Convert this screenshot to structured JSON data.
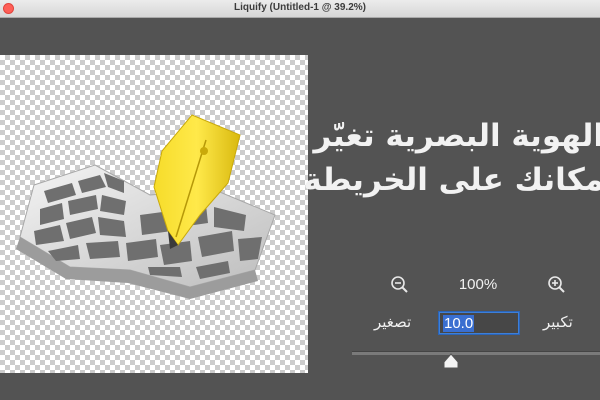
{
  "window": {
    "title": "Liquify (Untitled-1 @ 39.2%)"
  },
  "preview": {
    "description_icon": "map-with-pen-icon"
  },
  "headline": {
    "line1": "الهوية البصرية تغيّر",
    "line2": "مكانك على الخريطة"
  },
  "zoom": {
    "level": "100%",
    "shrink_label": "تصغير",
    "enlarge_label": "تكبير",
    "input_value": "10.0",
    "slider_fraction": 0.36
  },
  "colors": {
    "background": "#535353",
    "pen": "#f2d524",
    "map": "#d9d9d9",
    "accent": "#3a6fd0"
  }
}
